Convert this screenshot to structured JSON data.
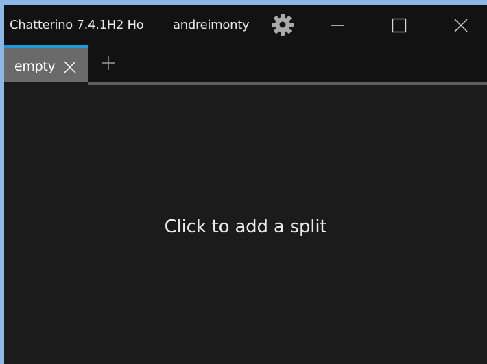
{
  "window": {
    "title": "Chatterino 7.4.1H2 Ho",
    "username": "andreimonty"
  },
  "icons": {
    "settings": "gear-icon",
    "minimize": "minimize-icon",
    "maximize": "maximize-icon",
    "close": "close-icon",
    "tab_close": "close-icon",
    "add_tab": "plus-icon"
  },
  "tabs": [
    {
      "label": "empty",
      "selected": true
    }
  ],
  "content": {
    "hint": "Click to add a split"
  },
  "colors": {
    "accent": "#1e9bd7",
    "background": "#1b1b1b",
    "titlebar": "#121212",
    "selected_tab": "#6a6a6a",
    "desktop": "#8db8e6"
  }
}
